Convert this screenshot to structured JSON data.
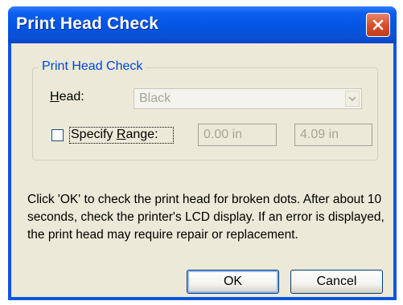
{
  "window": {
    "title": "Print Head Check",
    "close_icon": "close-x-icon"
  },
  "group": {
    "title": "Print Head Check",
    "head_label_key": "H",
    "head_label_rest": "ead:",
    "head_value": "Black",
    "range_label_pre": "Specify ",
    "range_label_key": "R",
    "range_label_rest": "ange:",
    "range_checked": false,
    "range_start": "0.00 in",
    "range_end": "4.09 in"
  },
  "message": "Click 'OK' to check the print head for broken dots. After about 10 seconds, check the printer's LCD display.  If an error is displayed, the print head may require repair or replacement.",
  "buttons": {
    "ok": "OK",
    "cancel": "Cancel"
  }
}
